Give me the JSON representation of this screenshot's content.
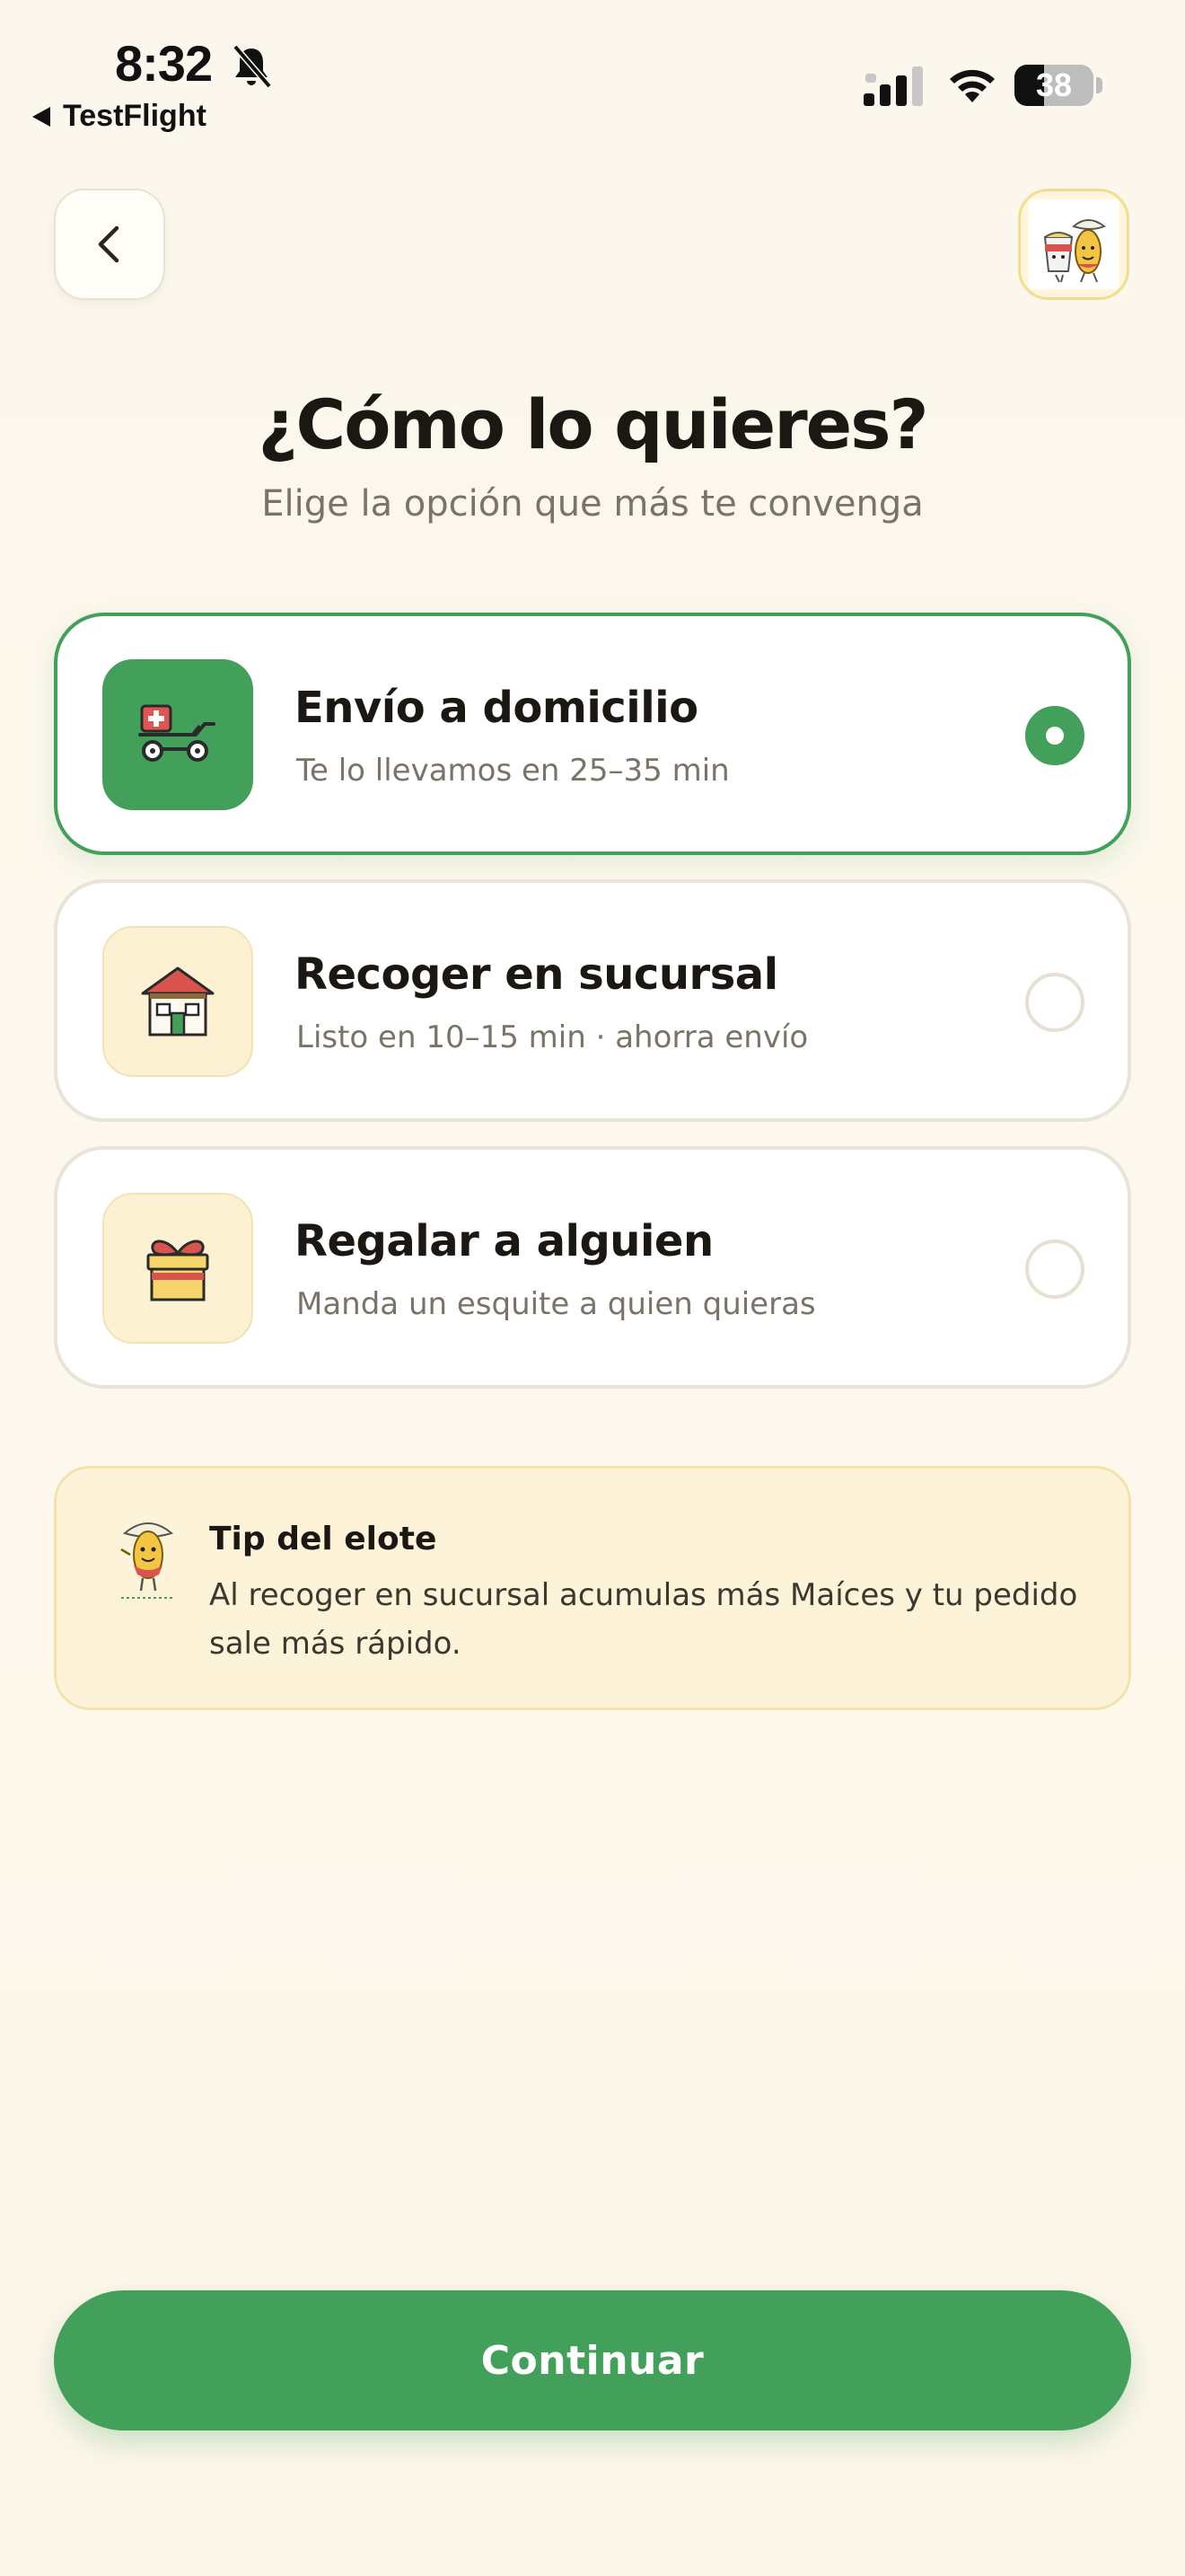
{
  "status_bar": {
    "time": "8:32",
    "back_app": "TestFlight",
    "battery": "38",
    "battery_level": 0.38,
    "icons": [
      "bell-slash-icon",
      "cellular-signal-icon",
      "wifi-icon",
      "battery-icon"
    ]
  },
  "header": {
    "back_icon": "chevron-left-icon",
    "avatar_icon": "mascot-avatar-icon"
  },
  "page": {
    "title": "¿Cómo lo quieres?",
    "subtitle": "Elige la opción que más te convenga"
  },
  "options": [
    {
      "title": "Envío a domicilio",
      "subtitle": "Te lo llevamos en 25–35 min",
      "icon": "delivery-cart-icon",
      "selected": true
    },
    {
      "title": "Recoger en sucursal",
      "subtitle": "Listo en 10–15 min · ahorra envío",
      "icon": "store-icon",
      "selected": false
    },
    {
      "title": "Regalar a alguien",
      "subtitle": "Manda un esquite a quien quieras",
      "icon": "gift-icon",
      "selected": false
    }
  ],
  "tip": {
    "title": "Tip del elote",
    "body": "Al recoger en sucursal acumulas más Maíces y tu pedido sale más rápido.",
    "icon": "elote-mascot-icon"
  },
  "cta": {
    "label": "Continuar"
  },
  "colors": {
    "accent": "#43a05b",
    "background": "#fcf7ec",
    "tip_background": "#fdf3d8"
  }
}
